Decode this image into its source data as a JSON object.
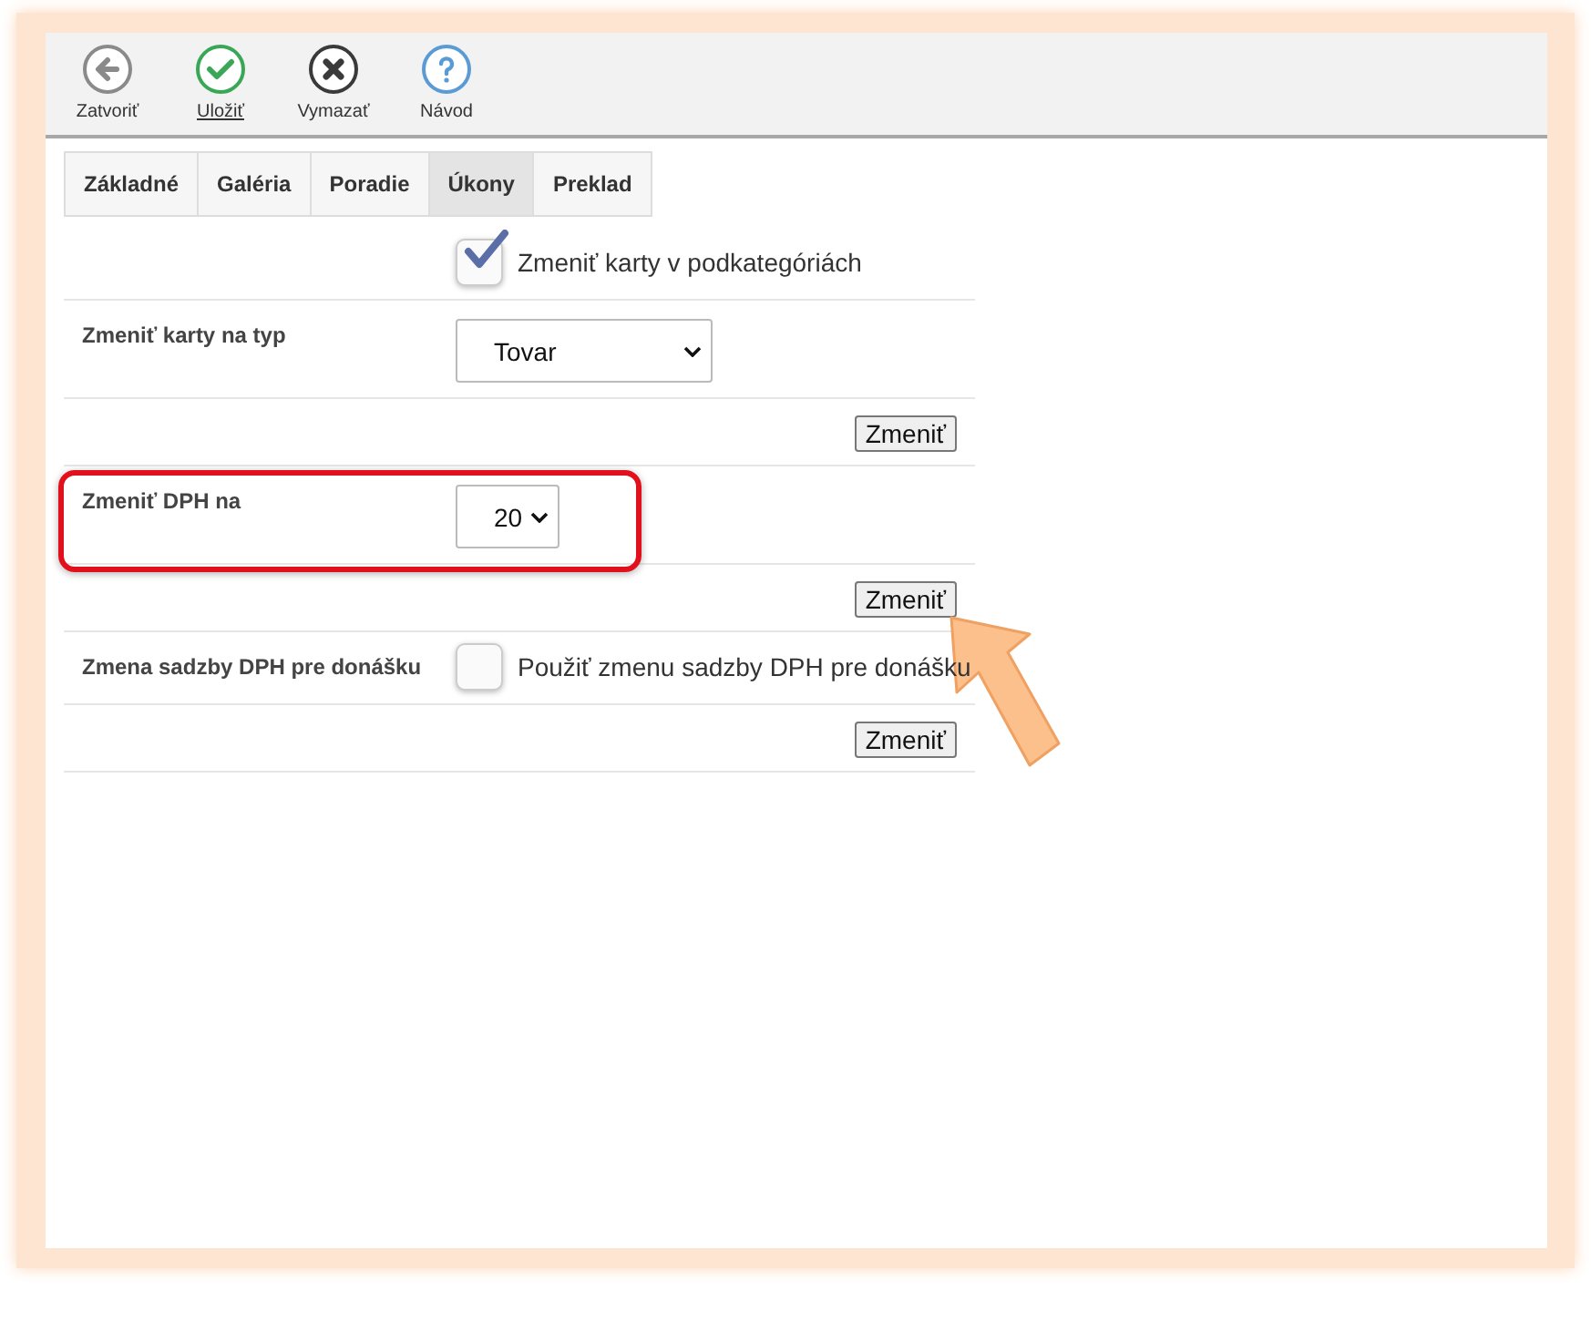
{
  "toolbar": [
    {
      "kind": "back",
      "label": "Zatvoriť",
      "underlined": false
    },
    {
      "kind": "save",
      "label": "Uložiť",
      "underlined": true
    },
    {
      "kind": "delete",
      "label": "Vymazať",
      "underlined": false
    },
    {
      "kind": "help",
      "label": "Návod",
      "underlined": false
    }
  ],
  "tabs": [
    {
      "label": "Základné",
      "selected": false
    },
    {
      "label": "Galéria",
      "selected": false
    },
    {
      "label": "Poradie",
      "selected": false
    },
    {
      "label": "Úkony",
      "selected": true
    },
    {
      "label": "Preklad",
      "selected": false
    }
  ],
  "rows": [
    {
      "kind": "checkbox",
      "option": "Zmeniť karty v podkategóriách",
      "checked": true
    },
    {
      "kind": "select",
      "label": "Zmeniť karty na typ",
      "value": "Tovar",
      "wide": true
    },
    {
      "kind": "action",
      "button": "Zmeniť"
    },
    {
      "kind": "select",
      "label": "Zmeniť DPH na",
      "value": "20",
      "wide": false,
      "highlighted": true
    },
    {
      "kind": "action",
      "button": "Zmeniť",
      "pointed": true
    },
    {
      "kind": "checkbox",
      "label": "Zmena sadzby DPH pre donášku",
      "option": "Použiť zmenu sadzby DPH pre donášku",
      "checked": false
    },
    {
      "kind": "action",
      "button": "Zmeniť"
    }
  ]
}
